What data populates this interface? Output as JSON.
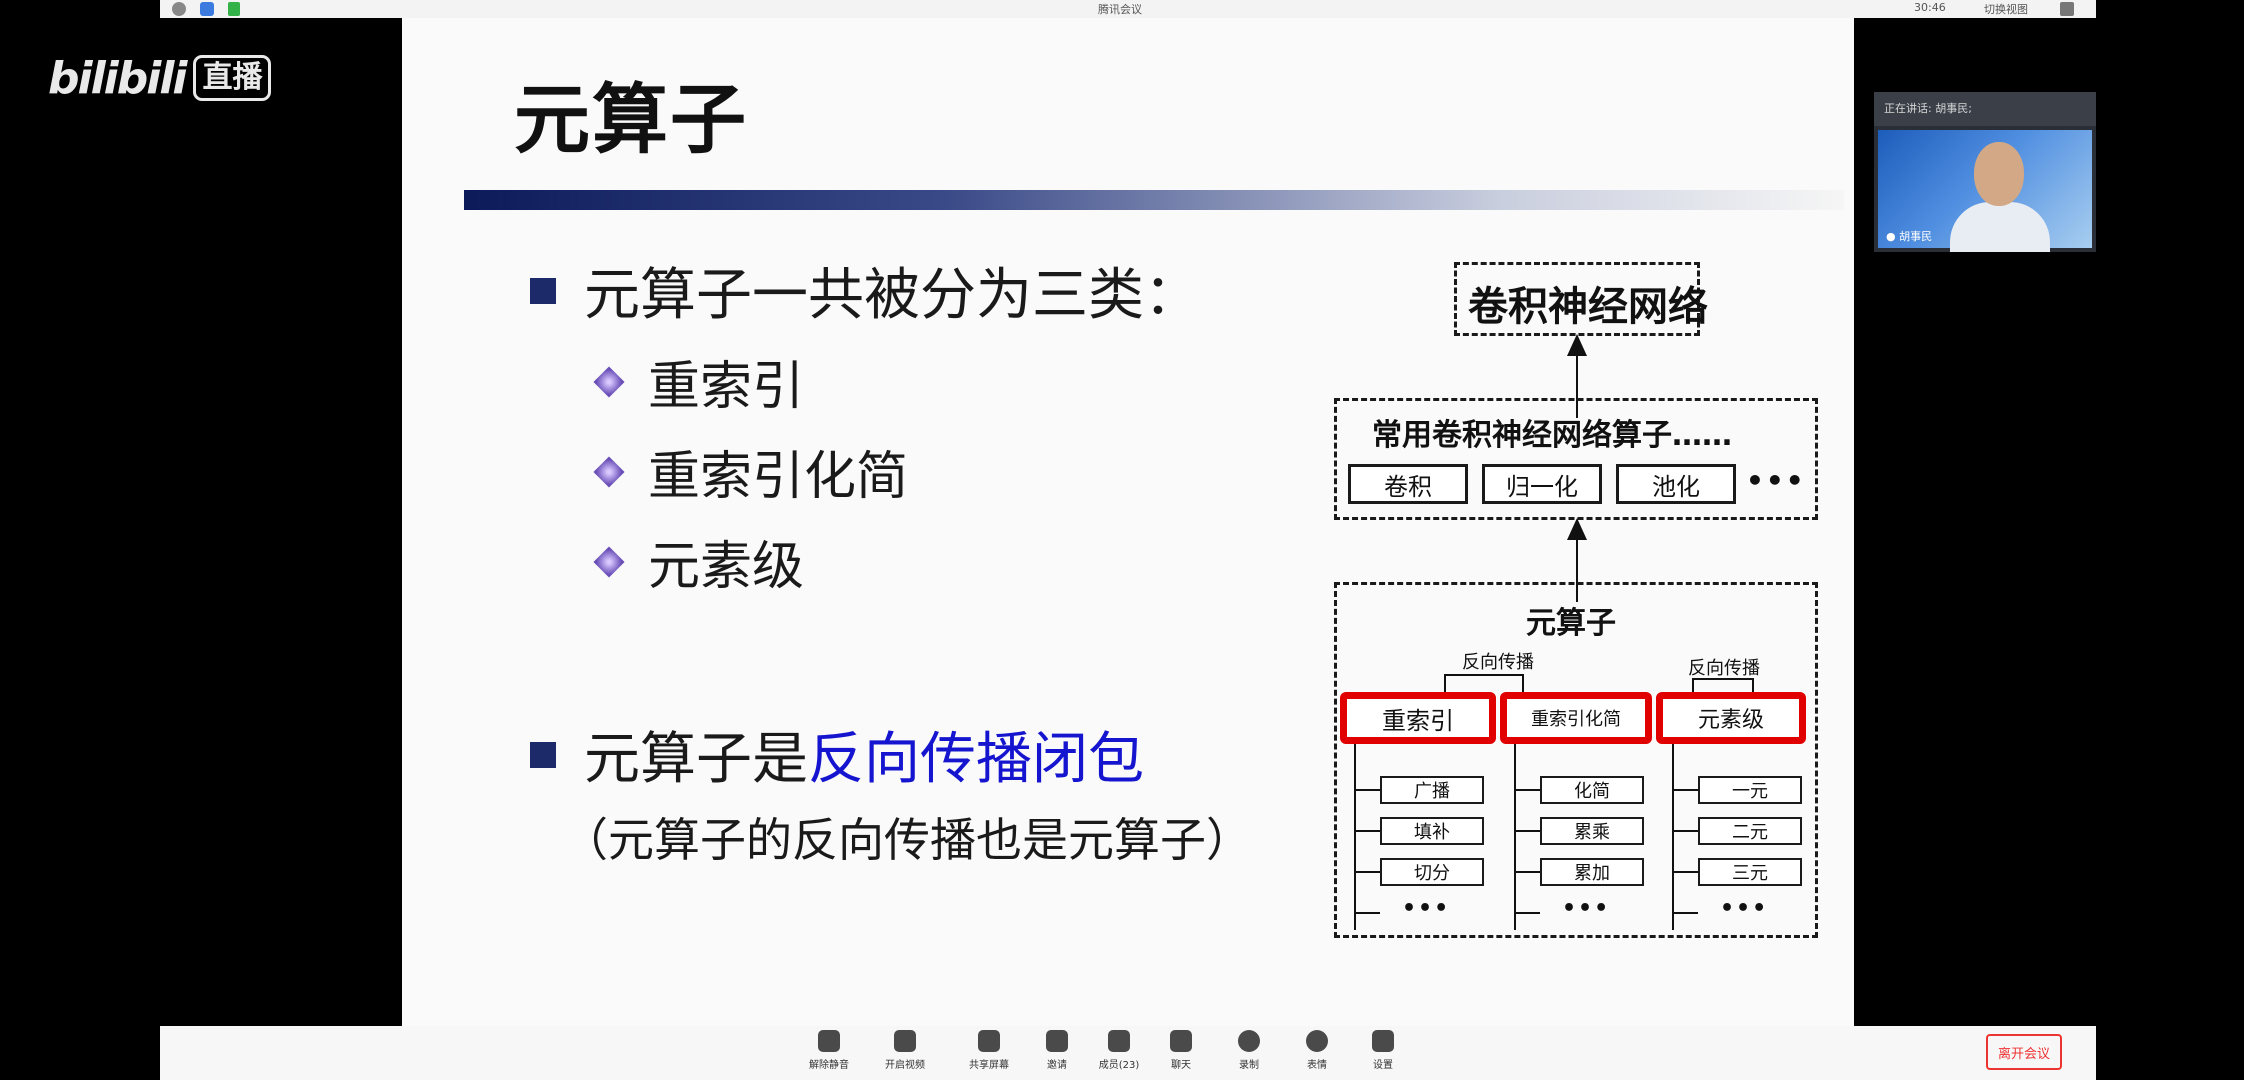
{
  "topbar": {
    "meeting_title": "腾讯会议",
    "clock": "30:46",
    "switch_view": "切换视图"
  },
  "watermark": {
    "logo_text": "bilibili",
    "badge": "直播"
  },
  "slide": {
    "title": "元算子",
    "bullets": [
      {
        "text": "元算子一共被分为三类："
      },
      {
        "text_prefix": "元算子是",
        "text_highlight": "反向传播闭包"
      }
    ],
    "sub_items": [
      "重索引",
      "重索引化简",
      "元素级"
    ],
    "note": "（元算子的反向传播也是元算子）",
    "highlight_color": "#1515d0",
    "diagram": {
      "top_box": "卷积神经网络",
      "mid_box_title": "常用卷积神经网络算子……",
      "mid_items": [
        "卷积",
        "归一化",
        "池化"
      ],
      "mid_more": "•••",
      "bottom_box_title": "元算子",
      "backprop_label_left": "反向传播",
      "backprop_label_right": "反向传播",
      "categories": [
        {
          "label": "重索引",
          "children": [
            "广播",
            "填补",
            "切分"
          ],
          "more": "•••"
        },
        {
          "label": "重索引化简",
          "children": [
            "化简",
            "累乘",
            "累加"
          ],
          "more": "•••"
        },
        {
          "label": "元素级",
          "children": [
            "一元",
            "二元",
            "三元"
          ],
          "more": "•••"
        }
      ],
      "highlight_border": "#e10000"
    }
  },
  "webcam": {
    "header": "正在讲话: 胡事民;",
    "name": "胡事民"
  },
  "toolbar": {
    "items": [
      {
        "label": "解除静音",
        "icon": "mic-muted-icon"
      },
      {
        "label": "开启视频",
        "icon": "camera-off-icon"
      },
      {
        "label": "共享屏幕",
        "icon": "screen-share-icon"
      },
      {
        "label": "邀请",
        "icon": "invite-icon"
      },
      {
        "label": "成员(23)",
        "icon": "members-icon"
      },
      {
        "label": "聊天",
        "icon": "chat-icon"
      },
      {
        "label": "录制",
        "icon": "record-icon"
      },
      {
        "label": "表情",
        "icon": "emoji-icon"
      },
      {
        "label": "设置",
        "icon": "settings-icon"
      }
    ],
    "leave_label": "离开会议",
    "leave_color": "#e33"
  }
}
